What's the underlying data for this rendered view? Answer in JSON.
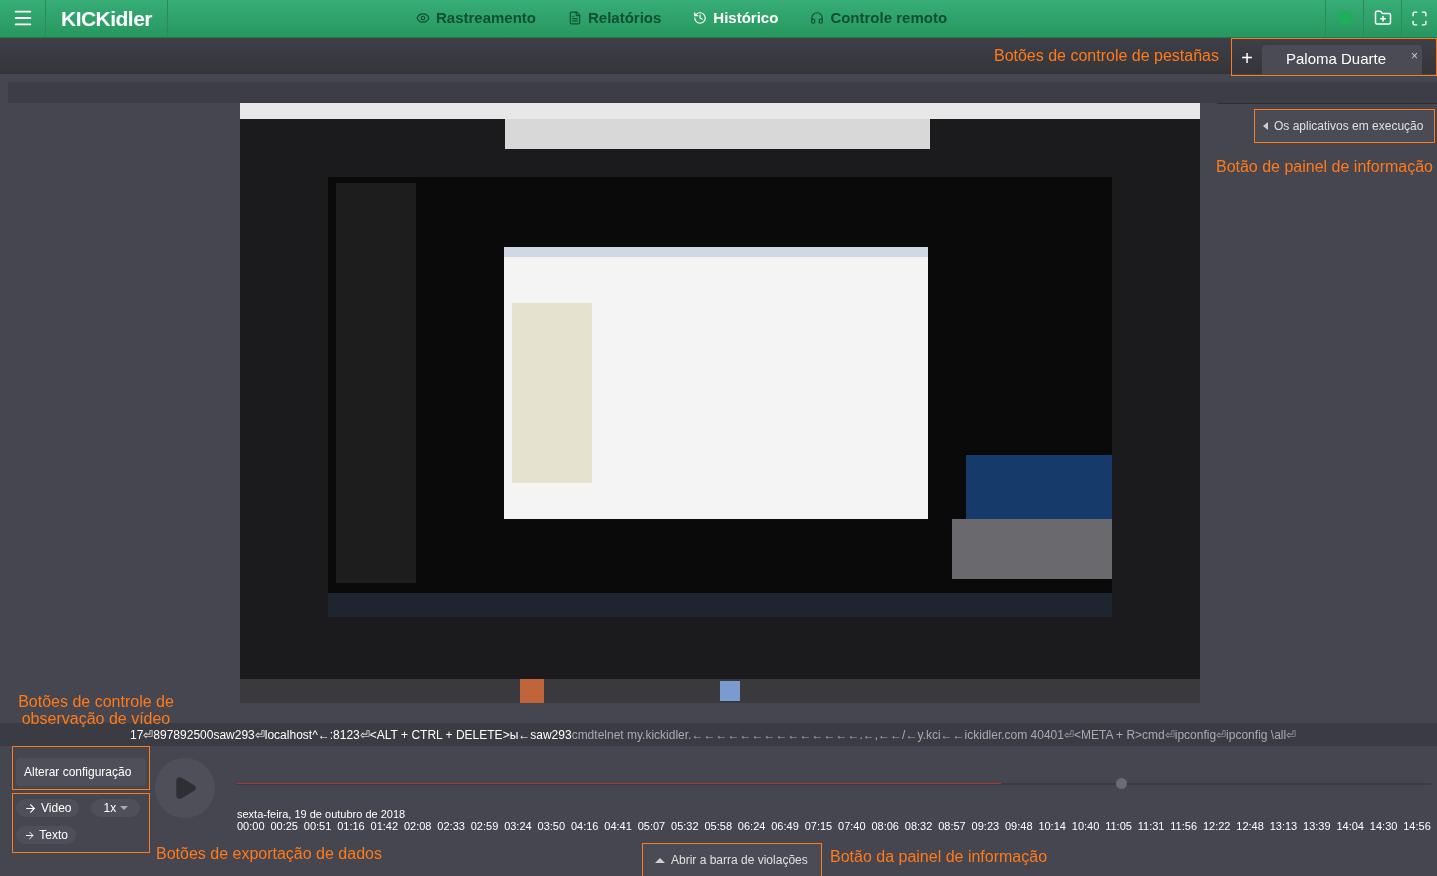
{
  "topbar": {
    "logo": "KICKidler",
    "nav": [
      {
        "label": "Rastreamento",
        "selected": false
      },
      {
        "label": "Relatórios",
        "selected": false
      },
      {
        "label": "Histórico",
        "selected": true
      },
      {
        "label": "Controle remoto",
        "selected": false
      }
    ],
    "status": {
      "color": "#1fae5a"
    }
  },
  "tabs": {
    "annotation": "Botões de controle de pestañas",
    "add": "+",
    "items": [
      {
        "label": "Paloma Duarte",
        "close": "×",
        "selected": true
      }
    ]
  },
  "info_panel": {
    "button": "Os aplicativos em execução",
    "annotation": "Botão de painel de informação"
  },
  "keylog": {
    "typed": "17⏎897892500saw293⏎localhost^←:8123⏎<ALT + CTRL + DELETE>ы←saw293",
    "rest": "cmdtelnet my.kickidler.←←←←←←←←←←←←←←.←,←←/←y.kci←←ickidler.com 40401⏎<META + R>cmd⏎ipconfig⏎ipconfig \\all⏎"
  },
  "controls": {
    "annotation": "Botões de controle de observação de vídeo",
    "settings_button": "Alterar configuração"
  },
  "export": {
    "video": "Video",
    "speed": "1x",
    "text": "Texto",
    "annotation": "Botões de exportação de dados"
  },
  "timeline": {
    "played": {
      "level": 0.64
    },
    "cursor": {
      "level": 0.74
    },
    "date": "sexta-feira, 19 de outubro de 2018",
    "ticks": [
      "00:00",
      "00:25",
      "00:51",
      "01:16",
      "01:42",
      "02:08",
      "02:33",
      "02:59",
      "03:24",
      "03:50",
      "04:16",
      "04:41",
      "05:07",
      "05:32",
      "05:58",
      "06:24",
      "06:49",
      "07:15",
      "07:40",
      "08:06",
      "08:32",
      "08:57",
      "09:23",
      "09:48",
      "10:14",
      "10:40",
      "11:05",
      "11:31",
      "11:56",
      "12:22",
      "12:48",
      "13:13",
      "13:39",
      "14:04",
      "14:30",
      "14:56"
    ]
  },
  "violations": {
    "button": "Abrir a barra de violações",
    "annotation": "Botão da painel de informação"
  }
}
